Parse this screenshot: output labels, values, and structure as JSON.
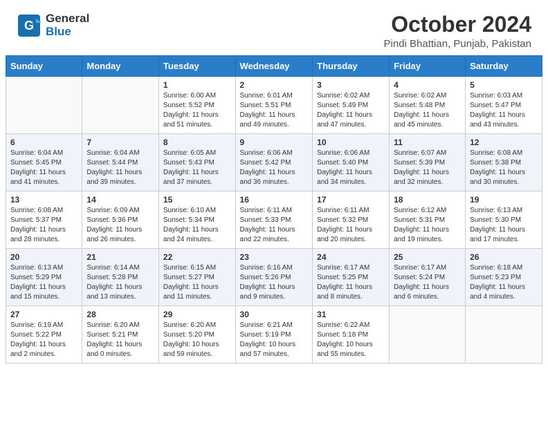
{
  "header": {
    "logo_line1": "General",
    "logo_line2": "Blue",
    "title": "October 2024",
    "subtitle": "Pindi Bhattian, Punjab, Pakistan"
  },
  "calendar": {
    "days_of_week": [
      "Sunday",
      "Monday",
      "Tuesday",
      "Wednesday",
      "Thursday",
      "Friday",
      "Saturday"
    ],
    "weeks": [
      [
        {
          "num": "",
          "info": ""
        },
        {
          "num": "",
          "info": ""
        },
        {
          "num": "1",
          "info": "Sunrise: 6:00 AM\nSunset: 5:52 PM\nDaylight: 11 hours and 51 minutes."
        },
        {
          "num": "2",
          "info": "Sunrise: 6:01 AM\nSunset: 5:51 PM\nDaylight: 11 hours and 49 minutes."
        },
        {
          "num": "3",
          "info": "Sunrise: 6:02 AM\nSunset: 5:49 PM\nDaylight: 11 hours and 47 minutes."
        },
        {
          "num": "4",
          "info": "Sunrise: 6:02 AM\nSunset: 5:48 PM\nDaylight: 11 hours and 45 minutes."
        },
        {
          "num": "5",
          "info": "Sunrise: 6:03 AM\nSunset: 5:47 PM\nDaylight: 11 hours and 43 minutes."
        }
      ],
      [
        {
          "num": "6",
          "info": "Sunrise: 6:04 AM\nSunset: 5:45 PM\nDaylight: 11 hours and 41 minutes."
        },
        {
          "num": "7",
          "info": "Sunrise: 6:04 AM\nSunset: 5:44 PM\nDaylight: 11 hours and 39 minutes."
        },
        {
          "num": "8",
          "info": "Sunrise: 6:05 AM\nSunset: 5:43 PM\nDaylight: 11 hours and 37 minutes."
        },
        {
          "num": "9",
          "info": "Sunrise: 6:06 AM\nSunset: 5:42 PM\nDaylight: 11 hours and 36 minutes."
        },
        {
          "num": "10",
          "info": "Sunrise: 6:06 AM\nSunset: 5:40 PM\nDaylight: 11 hours and 34 minutes."
        },
        {
          "num": "11",
          "info": "Sunrise: 6:07 AM\nSunset: 5:39 PM\nDaylight: 11 hours and 32 minutes."
        },
        {
          "num": "12",
          "info": "Sunrise: 6:08 AM\nSunset: 5:38 PM\nDaylight: 11 hours and 30 minutes."
        }
      ],
      [
        {
          "num": "13",
          "info": "Sunrise: 6:08 AM\nSunset: 5:37 PM\nDaylight: 11 hours and 28 minutes."
        },
        {
          "num": "14",
          "info": "Sunrise: 6:09 AM\nSunset: 5:36 PM\nDaylight: 11 hours and 26 minutes."
        },
        {
          "num": "15",
          "info": "Sunrise: 6:10 AM\nSunset: 5:34 PM\nDaylight: 11 hours and 24 minutes."
        },
        {
          "num": "16",
          "info": "Sunrise: 6:11 AM\nSunset: 5:33 PM\nDaylight: 11 hours and 22 minutes."
        },
        {
          "num": "17",
          "info": "Sunrise: 6:11 AM\nSunset: 5:32 PM\nDaylight: 11 hours and 20 minutes."
        },
        {
          "num": "18",
          "info": "Sunrise: 6:12 AM\nSunset: 5:31 PM\nDaylight: 11 hours and 19 minutes."
        },
        {
          "num": "19",
          "info": "Sunrise: 6:13 AM\nSunset: 5:30 PM\nDaylight: 11 hours and 17 minutes."
        }
      ],
      [
        {
          "num": "20",
          "info": "Sunrise: 6:13 AM\nSunset: 5:29 PM\nDaylight: 11 hours and 15 minutes."
        },
        {
          "num": "21",
          "info": "Sunrise: 6:14 AM\nSunset: 5:28 PM\nDaylight: 11 hours and 13 minutes."
        },
        {
          "num": "22",
          "info": "Sunrise: 6:15 AM\nSunset: 5:27 PM\nDaylight: 11 hours and 11 minutes."
        },
        {
          "num": "23",
          "info": "Sunrise: 6:16 AM\nSunset: 5:26 PM\nDaylight: 11 hours and 9 minutes."
        },
        {
          "num": "24",
          "info": "Sunrise: 6:17 AM\nSunset: 5:25 PM\nDaylight: 11 hours and 8 minutes."
        },
        {
          "num": "25",
          "info": "Sunrise: 6:17 AM\nSunset: 5:24 PM\nDaylight: 11 hours and 6 minutes."
        },
        {
          "num": "26",
          "info": "Sunrise: 6:18 AM\nSunset: 5:23 PM\nDaylight: 11 hours and 4 minutes."
        }
      ],
      [
        {
          "num": "27",
          "info": "Sunrise: 6:19 AM\nSunset: 5:22 PM\nDaylight: 11 hours and 2 minutes."
        },
        {
          "num": "28",
          "info": "Sunrise: 6:20 AM\nSunset: 5:21 PM\nDaylight: 11 hours and 0 minutes."
        },
        {
          "num": "29",
          "info": "Sunrise: 6:20 AM\nSunset: 5:20 PM\nDaylight: 10 hours and 59 minutes."
        },
        {
          "num": "30",
          "info": "Sunrise: 6:21 AM\nSunset: 5:19 PM\nDaylight: 10 hours and 57 minutes."
        },
        {
          "num": "31",
          "info": "Sunrise: 6:22 AM\nSunset: 5:18 PM\nDaylight: 10 hours and 55 minutes."
        },
        {
          "num": "",
          "info": ""
        },
        {
          "num": "",
          "info": ""
        }
      ]
    ]
  }
}
